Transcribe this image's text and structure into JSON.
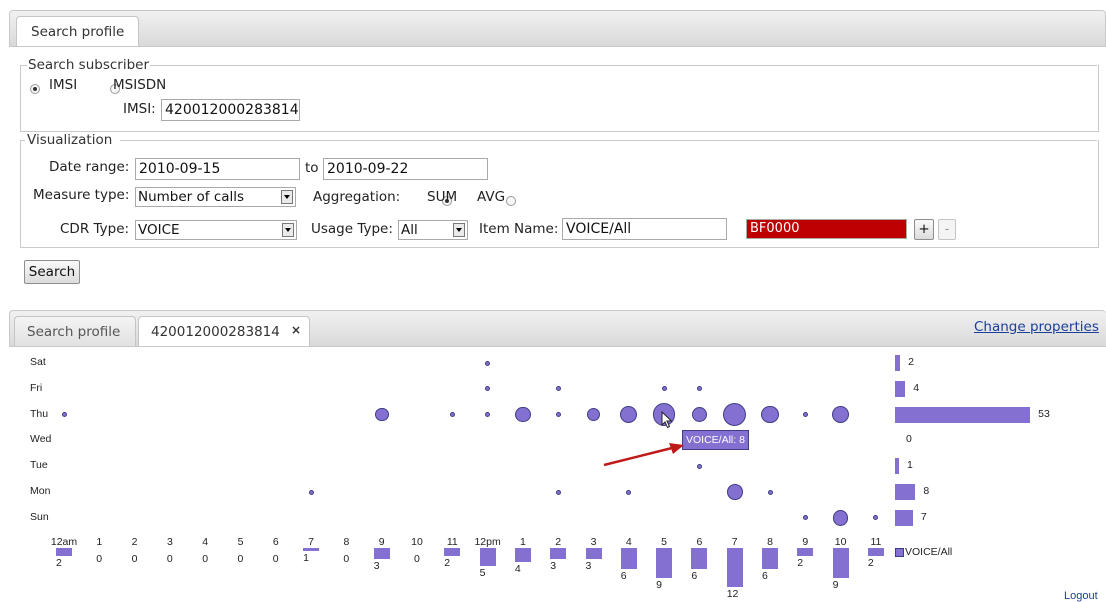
{
  "top_tabs": {
    "search_profile": "Search profile"
  },
  "search_subscriber": {
    "legend": "Search subscriber",
    "radio_imsi": "IMSI",
    "radio_msisdn": "MSISDN",
    "imsi_label": "IMSI:",
    "imsi_value": "420012000283814"
  },
  "visualization": {
    "legend": "Visualization",
    "date_range_label": "Date range:",
    "date_from": "2010-09-15",
    "to_label": "to",
    "date_to": "2010-09-22",
    "measure_type_label": "Measure type:",
    "measure_type_value": "Number of calls",
    "aggregation_label": "Aggregation:",
    "agg_sum": "SUM",
    "agg_avg": "AVG",
    "cdr_type_label": "CDR Type:",
    "cdr_type_value": "VOICE",
    "usage_type_label": "Usage Type:",
    "usage_type_value": "All",
    "item_name_label": "Item Name:",
    "item_name_value": "VOICE/All",
    "color_value": "BF0000",
    "color_hex": "#bf0000",
    "add_button": "+",
    "remove_button": "-"
  },
  "search_button": "Search",
  "result_tabs": {
    "search_profile": "Search profile",
    "imsi_tab": "420012000283814",
    "close_glyph": "×",
    "change_properties": "Change properties"
  },
  "logout": "Logout",
  "colors": {
    "series": "#8470d0",
    "border": "#3e3e86"
  },
  "chart_data": {
    "type": "scatter",
    "days": [
      "Sat",
      "Fri",
      "Thu",
      "Wed",
      "Tue",
      "Mon",
      "Sun"
    ],
    "hours": [
      "12am",
      "1",
      "2",
      "3",
      "4",
      "5",
      "6",
      "7",
      "8",
      "9",
      "10",
      "11",
      "12pm",
      "1",
      "2",
      "3",
      "4",
      "5",
      "6",
      "7",
      "8",
      "9",
      "10",
      "11"
    ],
    "hour_totals": [
      2,
      0,
      0,
      0,
      0,
      0,
      0,
      1,
      0,
      3,
      0,
      2,
      5,
      4,
      3,
      3,
      6,
      9,
      6,
      12,
      6,
      2,
      9,
      2
    ],
    "day_totals": [
      2,
      4,
      53,
      0,
      1,
      8,
      7
    ],
    "cells": [
      {
        "day": "Sat",
        "hour": 12,
        "value": 1
      },
      {
        "day": "Fri",
        "hour": 12,
        "value": 1
      },
      {
        "day": "Fri",
        "hour": 14,
        "value": 1
      },
      {
        "day": "Fri",
        "hour": 17,
        "value": 1
      },
      {
        "day": "Fri",
        "hour": 18,
        "value": 1
      },
      {
        "day": "Thu",
        "hour": 0,
        "value": 1
      },
      {
        "day": "Thu",
        "hour": 9,
        "value": 2
      },
      {
        "day": "Thu",
        "hour": 11,
        "value": 1
      },
      {
        "day": "Thu",
        "hour": 12,
        "value": 1
      },
      {
        "day": "Thu",
        "hour": 13,
        "value": 3
      },
      {
        "day": "Thu",
        "hour": 14,
        "value": 1
      },
      {
        "day": "Thu",
        "hour": 15,
        "value": 2
      },
      {
        "day": "Thu",
        "hour": 16,
        "value": 4
      },
      {
        "day": "Thu",
        "hour": 17,
        "value": 8
      },
      {
        "day": "Thu",
        "hour": 18,
        "value": 3
      },
      {
        "day": "Thu",
        "hour": 19,
        "value": 9
      },
      {
        "day": "Thu",
        "hour": 20,
        "value": 4
      },
      {
        "day": "Thu",
        "hour": 21,
        "value": 1
      },
      {
        "day": "Thu",
        "hour": 22,
        "value": 4
      },
      {
        "day": "Tue",
        "hour": 18,
        "value": 1
      },
      {
        "day": "Mon",
        "hour": 7,
        "value": 1
      },
      {
        "day": "Mon",
        "hour": 14,
        "value": 1
      },
      {
        "day": "Mon",
        "hour": 16,
        "value": 1
      },
      {
        "day": "Mon",
        "hour": 19,
        "value": 3
      },
      {
        "day": "Mon",
        "hour": 20,
        "value": 1
      },
      {
        "day": "Sun",
        "hour": 21,
        "value": 1
      },
      {
        "day": "Sun",
        "hour": 22,
        "value": 3
      },
      {
        "day": "Sun",
        "hour": 23,
        "value": 1
      }
    ],
    "tooltip": "VOICE/All: 8",
    "legend": "VOICE/All"
  }
}
